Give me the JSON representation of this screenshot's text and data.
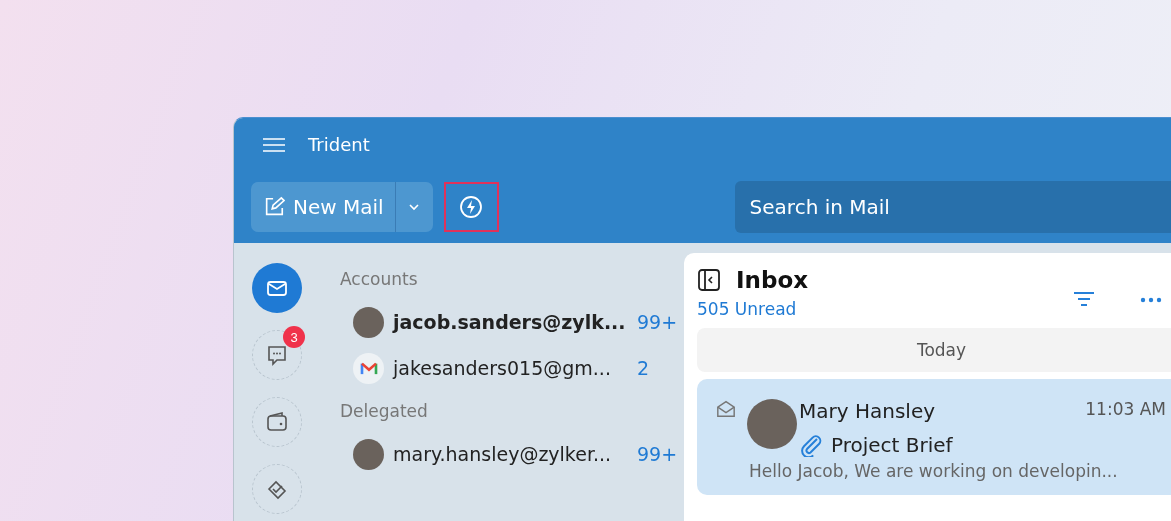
{
  "window": {
    "title": "Trident"
  },
  "toolbar": {
    "new_mail": "New Mail",
    "quick_action": {
      "highlighted": true
    },
    "search": {
      "placeholder": "Search in Mail"
    }
  },
  "rail": [
    {
      "kind": "mail",
      "selected": true
    },
    {
      "kind": "chat",
      "selected": false,
      "badge": "3"
    },
    {
      "kind": "wallet",
      "selected": false
    },
    {
      "kind": "tasks",
      "selected": false
    }
  ],
  "accounts": {
    "sections": [
      {
        "title": "Accounts",
        "items": [
          {
            "kind": "photo",
            "address": "jacob.sanders@zylk...",
            "count": "99+",
            "selected": true
          },
          {
            "kind": "gmail",
            "address": "jakesanders015@gm...",
            "count": "2",
            "selected": false
          }
        ]
      },
      {
        "title": "Delegated",
        "items": [
          {
            "kind": "photo",
            "address": "mary.hansley@zylker...",
            "count": "99+",
            "selected": false
          }
        ]
      }
    ]
  },
  "inbox": {
    "title": "Inbox",
    "unread": "505 Unread",
    "groups": [
      {
        "label": "Today",
        "messages": [
          {
            "sender": "Mary Hansley",
            "time": "11:03 AM",
            "subject": "Project Brief",
            "attachment": true,
            "preview": "Hello Jacob, We are working on developin...",
            "selected": true
          }
        ]
      }
    ]
  }
}
